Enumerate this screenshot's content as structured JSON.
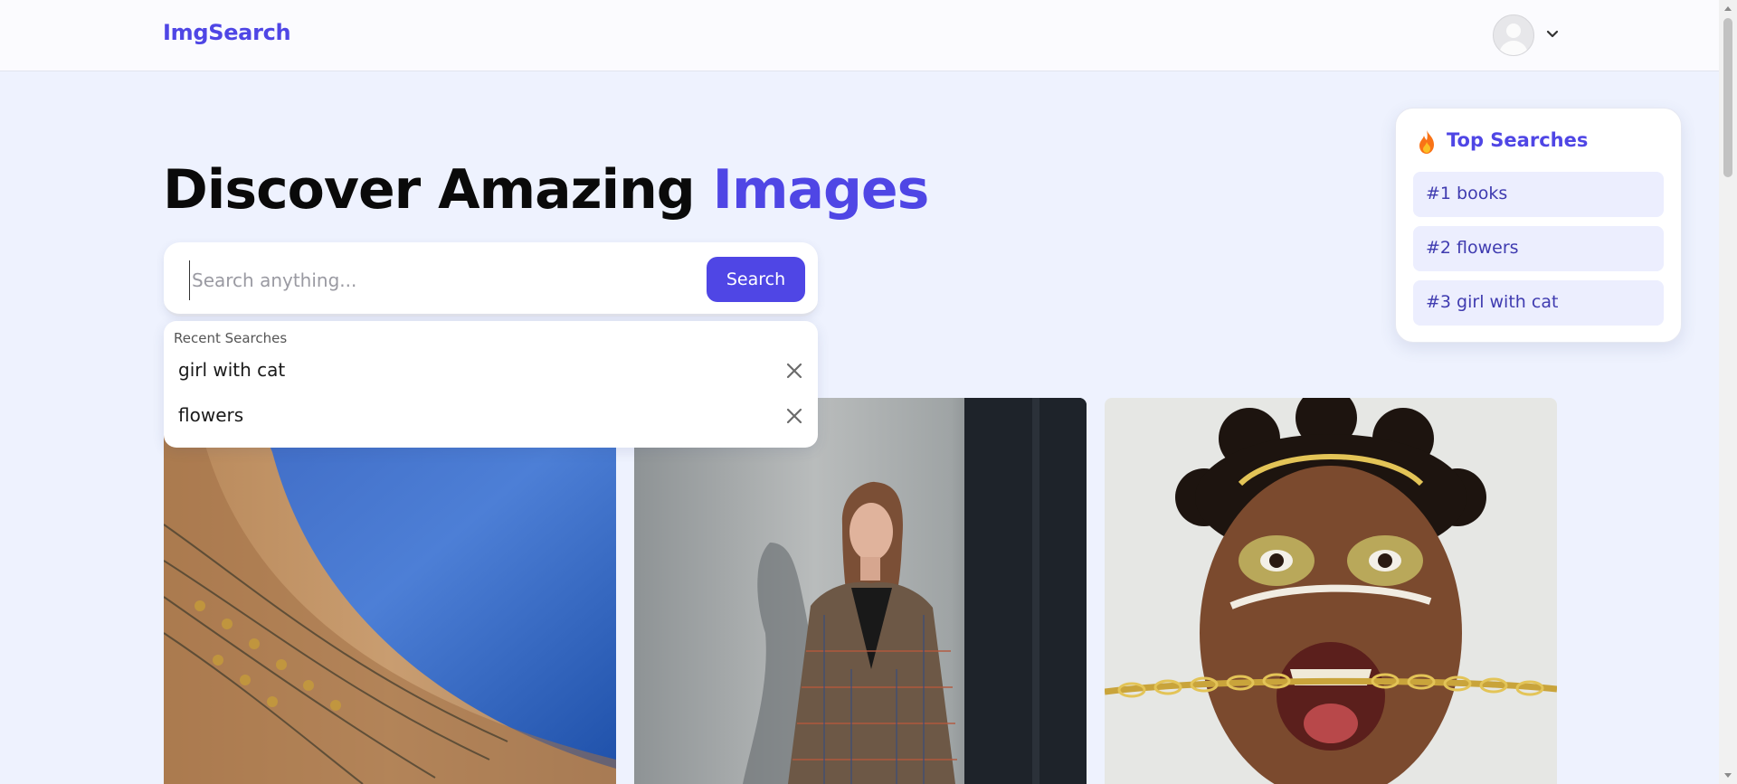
{
  "header": {
    "brand": "ImgSearch",
    "user_icon": "avatar-icon",
    "menu_icon": "chevron-down-icon"
  },
  "hero": {
    "title_main": "Discover Amazing ",
    "title_accent": "Images"
  },
  "search": {
    "placeholder": "Search anything...",
    "value": "",
    "button_label": "Search"
  },
  "recent": {
    "title": "Recent Searches",
    "items": [
      {
        "label": "girl with cat"
      },
      {
        "label": "flowers"
      }
    ],
    "remove_icon": "close-icon"
  },
  "top_searches": {
    "icon": "flame-icon",
    "title": "Top Searches",
    "items": [
      {
        "label": "#1 books"
      },
      {
        "label": "#2 flowers"
      },
      {
        "label": "#3 girl with cat"
      }
    ]
  },
  "gallery": {
    "images": [
      {
        "name": "architecture-photo"
      },
      {
        "name": "woman-in-coat-photo"
      },
      {
        "name": "painted-face-chains-photo"
      }
    ]
  },
  "colors": {
    "accent": "#4f46e5",
    "page_bg": "#eef2fe",
    "chip_bg": "#eceefe"
  }
}
